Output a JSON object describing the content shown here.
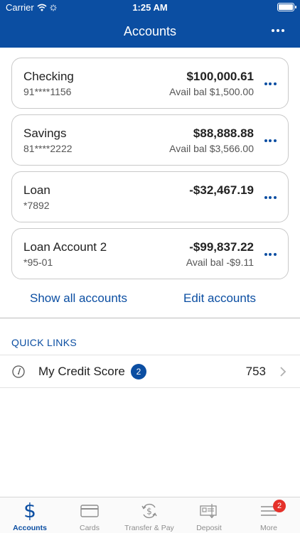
{
  "status_bar": {
    "carrier": "Carrier",
    "time": "1:25 AM"
  },
  "header": {
    "title": "Accounts",
    "more_icon": "more-horizontal-icon"
  },
  "accounts": [
    {
      "name": "Checking",
      "number": "91****1156",
      "balance": "$100,000.61",
      "available": "Avail bal $1,500.00"
    },
    {
      "name": "Savings",
      "number": "81****2222",
      "balance": "$88,888.88",
      "available": "Avail bal $3,566.00"
    },
    {
      "name": "Loan",
      "number": "*7892",
      "balance": "-$32,467.19",
      "available": ""
    },
    {
      "name": "Loan Account 2",
      "number": "*95-01",
      "balance": "-$99,837.22",
      "available": "Avail bal -$9.11"
    }
  ],
  "account_links": {
    "show_all": "Show all accounts",
    "edit": "Edit accounts"
  },
  "quick_links": {
    "title": "QUICK LINKS",
    "items": [
      {
        "label": "My Credit Score",
        "badge": "2",
        "value": "753",
        "icon": "gauge-icon"
      }
    ]
  },
  "tabbar": {
    "tabs": [
      {
        "label": "Accounts",
        "icon": "dollar-icon",
        "active": true
      },
      {
        "label": "Cards",
        "icon": "card-icon",
        "active": false
      },
      {
        "label": "Transfer & Pay",
        "icon": "transfer-icon",
        "active": false
      },
      {
        "label": "Deposit",
        "icon": "deposit-check-icon",
        "active": false
      },
      {
        "label": "More",
        "icon": "menu-icon",
        "active": false,
        "badge": "2"
      }
    ]
  },
  "colors": {
    "brand": "#0b4ea2",
    "badge_red": "#e5312a",
    "muted": "#8e8e8e"
  }
}
